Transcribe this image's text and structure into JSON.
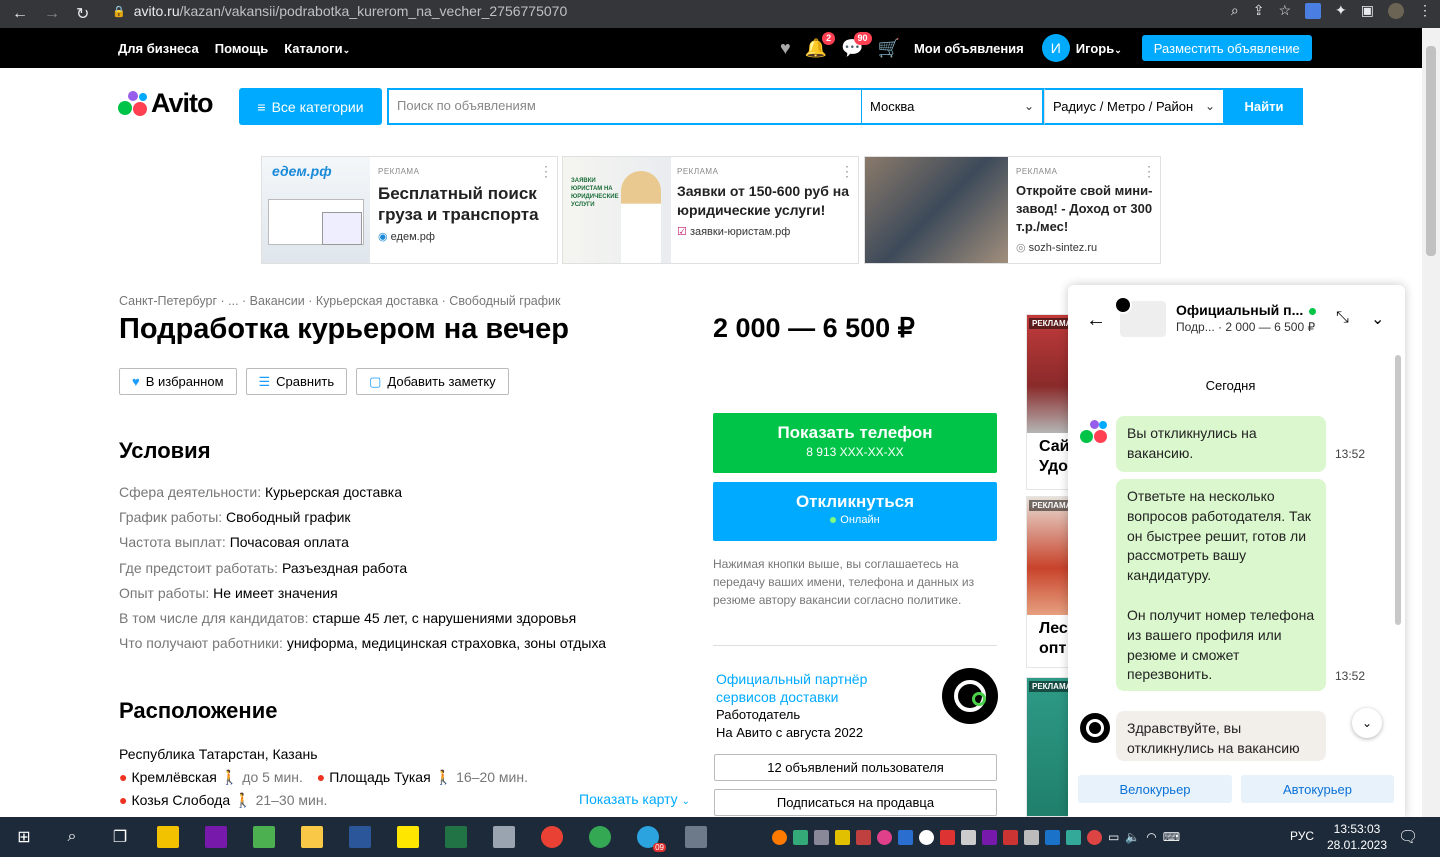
{
  "browser": {
    "url_domain": "avito.ru",
    "url_path": "/kazan/vakansii/podrabotka_kurerom_na_vecher_2756775070"
  },
  "topnav": {
    "links": [
      "Для бизнеса",
      "Помощь",
      "Каталоги"
    ],
    "notif_badge": "2",
    "msg_badge": "90",
    "my_ads": "Мои объявления",
    "avatar_letter": "И",
    "user_name": "Игорь",
    "post_ad": "Разместить объявление"
  },
  "header": {
    "logo": "Avito",
    "categories": "Все категории",
    "search_placeholder": "Поиск по объявлениям",
    "city": "Москва",
    "radius": "Радиус / Метро / Район",
    "find": "Найти"
  },
  "ads": [
    {
      "brand": "едем.рф",
      "label": "РЕКЛАМА",
      "title": "Бесплатный поиск груза и транспорта",
      "source": "едем.рф"
    },
    {
      "label": "РЕКЛАМА",
      "title": "Заявки от 150-600 руб на юридические услуги!",
      "source": "заявки-юристам.рф",
      "img_text": "ЗАЯВКИ ЮРИСТАМ НА ЮРИДИЧЕСКИЕ УСЛУГИ"
    },
    {
      "label": "РЕКЛАМА",
      "title": "Откройте свой мини-завод! - Доход от 300 т.р./мес!",
      "source": "sozh-sintez.ru"
    }
  ],
  "breadcrumbs": "Санкт-Петербург · ... · Вакансии · Курьерская доставка · Свободный график",
  "title": "Подработка курьером на вечер",
  "actions": {
    "favorite": "В избранном",
    "compare": "Сравнить",
    "note": "Добавить заметку"
  },
  "conditions": {
    "heading": "Условия",
    "rows": [
      {
        "k": "Сфера деятельности:",
        "v": "Курьерская доставка"
      },
      {
        "k": "График работы:",
        "v": "Свободный график"
      },
      {
        "k": "Частота выплат:",
        "v": "Почасовая оплата"
      },
      {
        "k": "Где предстоит работать:",
        "v": "Разъездная работа"
      },
      {
        "k": "Опыт работы:",
        "v": "Не имеет значения"
      },
      {
        "k": "В том числе для кандидатов:",
        "v": "старше 45 лет, с нарушениями здоровья"
      },
      {
        "k": "Что получают работники:",
        "v": "униформа, медицинская страховка, зоны отдыха"
      }
    ]
  },
  "location": {
    "heading": "Расположение",
    "address": "Республика Татарстан, Казань",
    "metro": [
      {
        "name": "Кремлёвская",
        "time": "до 5 мин."
      },
      {
        "name": "Площадь Тукая",
        "time": "16–20 мин."
      },
      {
        "name": "Козья Слобода",
        "time": "21–30 мин."
      }
    ],
    "show_map": "Показать карту"
  },
  "price": "2 000 — 6 500 ₽",
  "phone_btn": {
    "label": "Показать телефон",
    "number": "8 913 XXX-XX-XX"
  },
  "reply_btn": {
    "label": "Откликнуться",
    "status": "Онлайн"
  },
  "agreement": "Нажимая кнопки выше, вы соглашаетесь на передачу ваших имени, телефона и данных из резюме автору вакансии согласно политике.",
  "seller": {
    "name_line1": "Официальный партнёр",
    "name_line2": "сервисов доставки",
    "type": "Работодатель",
    "since": "На Авито с августа 2022",
    "ads_btn": "12 объявлений пользователя",
    "subscribe_btn": "Подписаться на продавца"
  },
  "side_ads": [
    {
      "label": "РЕКЛАМА",
      "text": "Сай Удо"
    },
    {
      "label": "РЕКЛАМА",
      "text": "Лес опт"
    },
    {
      "label": "РЕКЛАМА",
      "text": ""
    }
  ],
  "chat": {
    "name": "Официальный п...",
    "subtitle_item": "Подр...",
    "subtitle_price": "· 2 000 — 6 500 ₽",
    "today": "Сегодня",
    "messages": [
      {
        "text": "Вы откликнулись на вакансию.",
        "time": "13:52"
      },
      {
        "text": "Ответьте на несколько вопросов работодателя. Так он быстрее решит, готов ли рассмотреть вашу кандидатуру.",
        "text2": "Он получит номер телефона из вашего профиля или резюме и сможет перезвонить.",
        "time": "13:52"
      },
      {
        "text": "Здравствуйте, вы откликнулись на вакансию"
      }
    ],
    "chips": [
      "Велокурьер",
      "Автокурьер"
    ]
  },
  "taskbar": {
    "lang": "РУС",
    "time": "13:53:03",
    "date": "28.01.2023",
    "tg_badge": "09"
  },
  "colors": {
    "brand_blue": "#00aaff",
    "green": "#00c448",
    "topbar": "#000000",
    "taskbar": "#1d2a3a"
  }
}
